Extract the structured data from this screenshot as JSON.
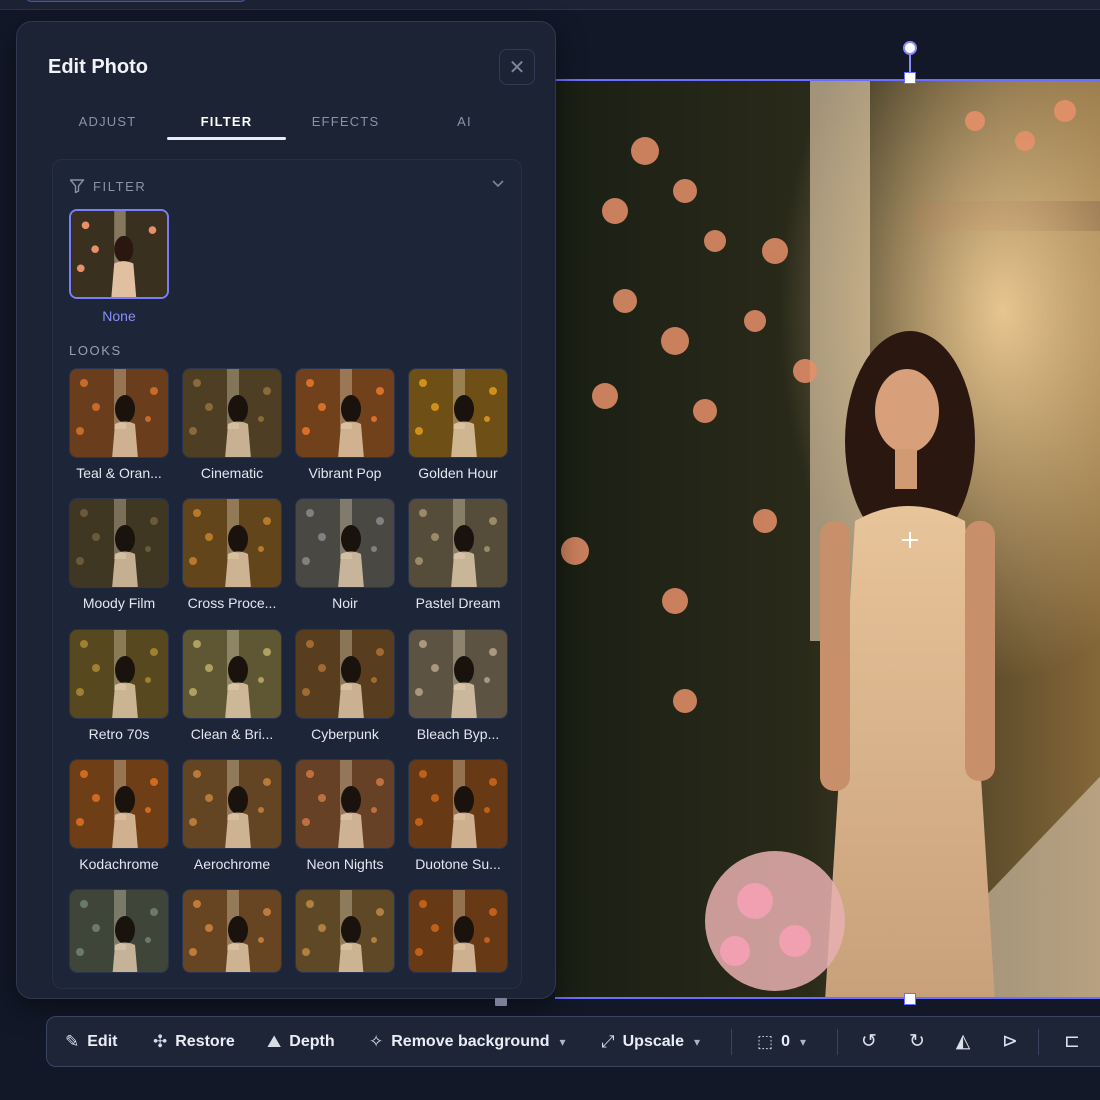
{
  "panel": {
    "title": "Edit Photo",
    "close_icon": "close-icon",
    "tabs": [
      {
        "label": "ADJUST",
        "active": false
      },
      {
        "label": "FILTER",
        "active": true
      },
      {
        "label": "EFFECTS",
        "active": false
      },
      {
        "label": "AI",
        "active": false
      }
    ],
    "filter_section": {
      "heading": "FILTER",
      "icon": "funnel-icon",
      "selected": {
        "label": "None"
      }
    },
    "looks_heading": "LOOKS",
    "looks": [
      {
        "label": "Teal & Oran...",
        "tint": "#c86a2a"
      },
      {
        "label": "Cinematic",
        "tint": "#8a6a3a"
      },
      {
        "label": "Vibrant Pop",
        "tint": "#d8702a"
      },
      {
        "label": "Golden Hour",
        "tint": "#d0901a"
      },
      {
        "label": "Moody Film",
        "tint": "#6a5a3a"
      },
      {
        "label": "Cross Proce...",
        "tint": "#b87a2a"
      },
      {
        "label": "Noir",
        "tint": "#808080"
      },
      {
        "label": "Pastel Dream",
        "tint": "#9a8a6a"
      },
      {
        "label": "Retro 70s",
        "tint": "#a08030"
      },
      {
        "label": "Clean & Bri...",
        "tint": "#b0a060"
      },
      {
        "label": "Cyberpunk",
        "tint": "#a06a30"
      },
      {
        "label": "Bleach Byp...",
        "tint": "#a89880"
      },
      {
        "label": "Kodachrome",
        "tint": "#d06a20"
      },
      {
        "label": "Aerochrome",
        "tint": "#b87a3a"
      },
      {
        "label": "Neon Nights",
        "tint": "#c07040"
      },
      {
        "label": "Duotone Su...",
        "tint": "#c0601a"
      },
      {
        "label": "",
        "tint": "#6a7a6a"
      },
      {
        "label": "",
        "tint": "#c07a3a"
      },
      {
        "label": "",
        "tint": "#b08040"
      },
      {
        "label": "",
        "tint": "#c0601a"
      }
    ]
  },
  "toolbar": {
    "edit": "Edit",
    "restore": "Restore",
    "depth": "Depth",
    "remove_background": "Remove background",
    "upscale": "Upscale",
    "corner_radius": "0"
  }
}
